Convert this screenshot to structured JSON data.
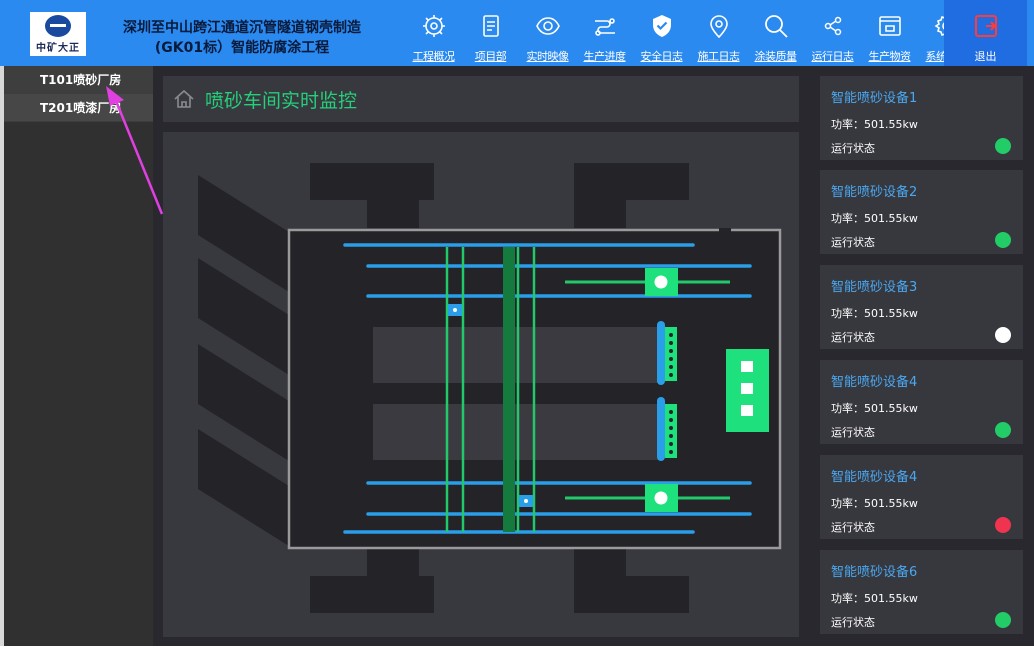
{
  "header": {
    "logo_text": "中矿大正",
    "title_line1": "深圳至中山跨江通道沉管隧道钢壳制造",
    "title_line2": "(GK01标）智能防腐涂工程",
    "nav": [
      {
        "label": "工程概况",
        "icon": "gear-brain-icon"
      },
      {
        "label": "项目部",
        "icon": "document-icon"
      },
      {
        "label": "实时映像",
        "icon": "eye-icon"
      },
      {
        "label": "生产进度",
        "icon": "progress-icon"
      },
      {
        "label": "安全日志",
        "icon": "shield-check-icon"
      },
      {
        "label": "施工日志",
        "icon": "location-pin-icon"
      },
      {
        "label": "涂装质量",
        "icon": "search-icon"
      },
      {
        "label": "运行日志",
        "icon": "share-icon"
      },
      {
        "label": "生产物资",
        "icon": "box-window-icon"
      },
      {
        "label": "系统管理",
        "icon": "gear-icon"
      }
    ],
    "exit_label": "退出"
  },
  "sidebar": {
    "items": [
      {
        "label": "T101喷砂厂房"
      },
      {
        "label": "T201喷漆厂房"
      }
    ]
  },
  "main": {
    "title": "喷砂车间实时监控"
  },
  "devices": [
    {
      "name": "智能喷砂设备1",
      "power": "功率：501.55kw",
      "status_label": "运行状态",
      "status_color": "#22cc66"
    },
    {
      "name": "智能喷砂设备2",
      "power": "功率：501.55kw",
      "status_label": "运行状态",
      "status_color": "#22cc66"
    },
    {
      "name": "智能喷砂设备3",
      "power": "功率：501.55kw",
      "status_label": "运行状态",
      "status_color": "#ffffff"
    },
    {
      "name": "智能喷砂设备4",
      "power": "功率：501.55kw",
      "status_label": "运行状态",
      "status_color": "#22cc66"
    },
    {
      "name": "智能喷砂设备4",
      "power": "功率：501.55kw",
      "status_label": "运行状态",
      "status_color": "#f0334f"
    },
    {
      "name": "智能喷砂设备6",
      "power": "功率：501.55kw",
      "status_label": "运行状态",
      "status_color": "#22cc66"
    }
  ],
  "colors": {
    "header_bg": "#2a8af0",
    "accent_green": "#24d07a",
    "accent_blue": "#4aa8f0",
    "panel_bg": "#28282e",
    "annotation": "#e040e0"
  }
}
